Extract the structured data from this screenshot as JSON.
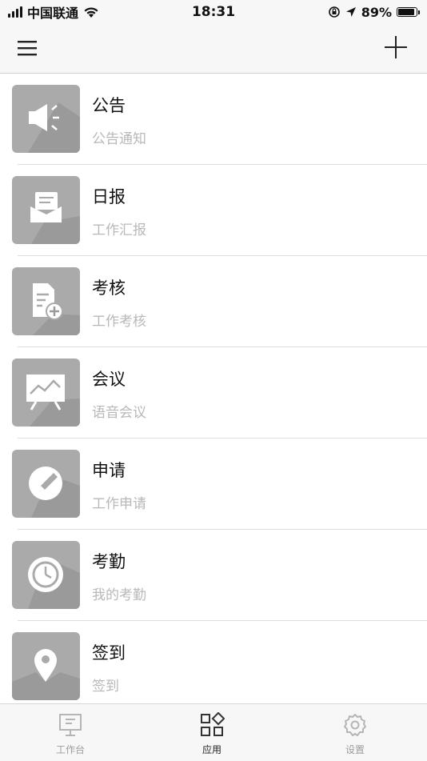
{
  "status_bar": {
    "carrier": "中国联通",
    "time": "18:31",
    "battery": "89%",
    "battery_level": 0.89,
    "icons": [
      "signal-icon",
      "wifi-icon",
      "orientation-lock-icon",
      "location-arrow-icon",
      "battery-icon"
    ]
  },
  "nav_bar": {
    "left_icon": "menu-icon",
    "right_icon": "plus-icon"
  },
  "items": [
    {
      "title": "公告",
      "subtitle": "公告通知",
      "icon": "megaphone-icon"
    },
    {
      "title": "日报",
      "subtitle": "工作汇报",
      "icon": "mail-icon"
    },
    {
      "title": "考核",
      "subtitle": "工作考核",
      "icon": "document-add-icon"
    },
    {
      "title": "会议",
      "subtitle": "语音会议",
      "icon": "presentation-board-icon"
    },
    {
      "title": "申请",
      "subtitle": "工作申请",
      "icon": "edit-pencil-icon"
    },
    {
      "title": "考勤",
      "subtitle": "我的考勤",
      "icon": "clock-icon"
    },
    {
      "title": "签到",
      "subtitle": "签到",
      "icon": "location-pin-icon"
    }
  ],
  "tab_bar": {
    "tabs": [
      {
        "label": "工作台",
        "icon": "monitor-icon",
        "active": false
      },
      {
        "label": "应用",
        "icon": "apps-grid-icon",
        "active": true
      },
      {
        "label": "设置",
        "icon": "settings-gear-icon",
        "active": false
      }
    ]
  },
  "colors": {
    "tile_background": "#aaaaaa",
    "tile_shadow": "#9a9a9a",
    "subtitle_text": "#b8b8b8",
    "divider": "#dedede"
  }
}
